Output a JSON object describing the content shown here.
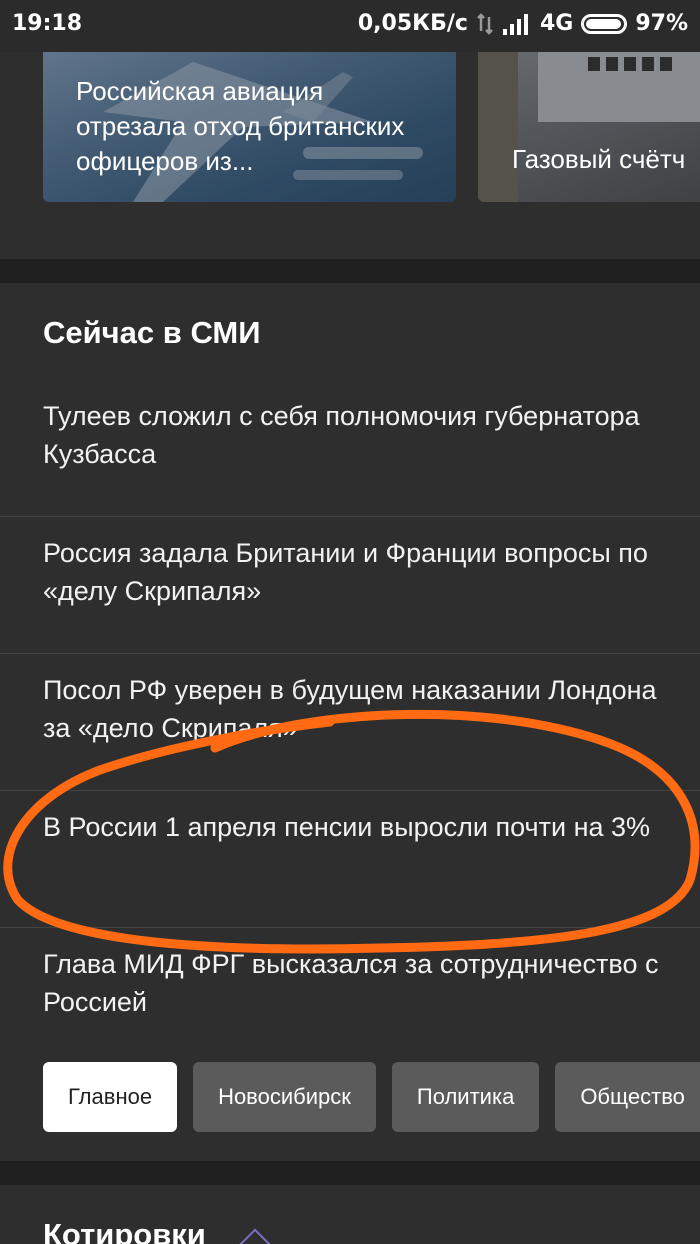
{
  "status_bar": {
    "time": "19:18",
    "speed": "0,05КБ/с",
    "network": "4G",
    "battery": "97%",
    "battery_level": 0.97
  },
  "top_cards": [
    {
      "title": "Российская авиация отрезала отход британских офицеров из..."
    },
    {
      "title": "Газовый счётч"
    }
  ],
  "news": {
    "title": "Сейчас в СМИ",
    "items": [
      {
        "text": "Тулеев сложил с себя полномочия губернатора Кузбасса"
      },
      {
        "text": "Россия задала Британии и Франции вопросы по «делу Скрипаля»"
      },
      {
        "text": "Посол РФ уверен в будущем наказании Лондона за «дело Скрипаля»"
      },
      {
        "text": "В России 1 апреля пенсии выросли почти на 3%"
      },
      {
        "text": "Глава МИД ФРГ высказался за сотрудничество с Россией"
      }
    ],
    "chips": [
      {
        "label": "Главное",
        "active": true
      },
      {
        "label": "Новосибирск",
        "active": false
      },
      {
        "label": "Политика",
        "active": false
      },
      {
        "label": "Общество",
        "active": false
      }
    ]
  },
  "quotes": {
    "title": "Котировки"
  },
  "colors": {
    "background": "#2e2e2e",
    "band": "#1f1f1f",
    "annotation": "#ff6a13",
    "chip_inactive": "#5b5b5b",
    "chip_active": "#ffffff"
  }
}
